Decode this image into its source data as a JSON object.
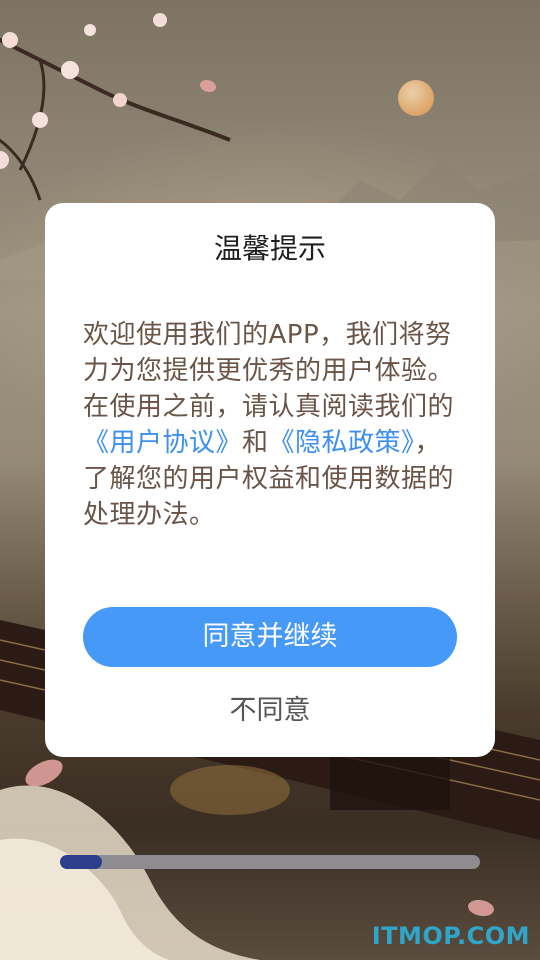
{
  "dialog": {
    "title": "温馨提示",
    "body": {
      "intro": "欢迎使用我们的APP，我们将努力为您提供更优秀的用户体验。在使用之前，请认真阅读我们的",
      "user_agreement": "《用户协议》",
      "and": "和",
      "privacy_policy": "《隐私政策》",
      "outro": "，了解您的用户权益和使用数据的处理办法。"
    },
    "agree_label": "同意并继续",
    "disagree_label": "不同意"
  },
  "progress": {
    "fraction": 0.1
  },
  "watermark": "ITMOP.COM",
  "colors": {
    "primary_button": "#4799f7",
    "link": "#3d8ff0",
    "progress_fill": "#2c3e8c",
    "progress_track": "#8e8c90"
  }
}
